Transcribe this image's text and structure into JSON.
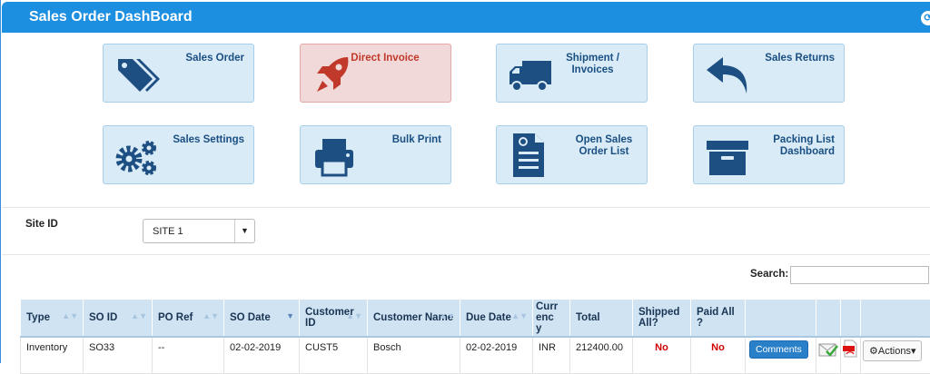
{
  "app": {
    "title": "Sales Order DashBoard",
    "corner_icon": "collapse-icon"
  },
  "tiles": [
    {
      "label": "Sales Order",
      "icon": "tags-icon"
    },
    {
      "label": "Direct Invoice",
      "icon": "rocket-icon"
    },
    {
      "label": "Shipment / Invoices",
      "icon": "truck-icon"
    },
    {
      "label": "Sales Returns",
      "icon": "reply-icon"
    },
    {
      "label": "Sales Settings",
      "icon": "gears-icon"
    },
    {
      "label": "Bulk Print",
      "icon": "printer-icon"
    },
    {
      "label": "Open Sales Order List",
      "icon": "document-refresh-icon"
    },
    {
      "label": "Packing List Dashboard",
      "icon": "archive-box-icon"
    }
  ],
  "site": {
    "label": "Site ID",
    "selected": "SITE 1"
  },
  "search": {
    "label": "Search:",
    "value": ""
  },
  "table": {
    "headers": [
      "Type",
      "SO ID",
      "PO Ref",
      "SO Date",
      "Customer ID",
      "Customer Name",
      "Due Date",
      "Currency",
      "Total",
      "Shipped All?",
      "Paid All ?"
    ],
    "rows": [
      {
        "type": "Inventory",
        "so_id": "SO33",
        "po_ref": "--",
        "so_date": "02-02-2019",
        "customer_id": "CUST5",
        "customer_name": "Bosch",
        "due_date": "02-02-2019",
        "currency": "INR",
        "total": "212400.00",
        "shipped_all": "No",
        "paid_all": "No",
        "comments_label": "Comments",
        "actions_label": "Actions"
      }
    ]
  },
  "colors": {
    "accent": "#1d8fe1",
    "tile": "#d9ebf7",
    "tile_red": "#f2d9d9",
    "no_red": "#d10000"
  }
}
